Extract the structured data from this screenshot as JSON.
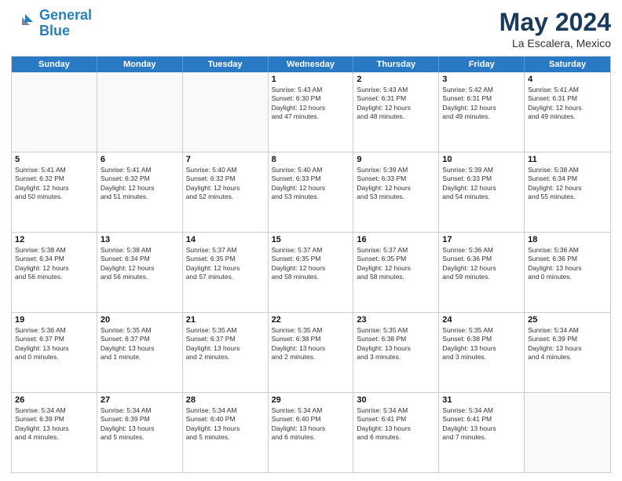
{
  "header": {
    "logo_line1": "General",
    "logo_line2": "Blue",
    "month": "May 2024",
    "location": "La Escalera, Mexico"
  },
  "weekdays": [
    "Sunday",
    "Monday",
    "Tuesday",
    "Wednesday",
    "Thursday",
    "Friday",
    "Saturday"
  ],
  "rows": [
    [
      {
        "day": "",
        "text": "",
        "empty": true
      },
      {
        "day": "",
        "text": "",
        "empty": true
      },
      {
        "day": "",
        "text": "",
        "empty": true
      },
      {
        "day": "1",
        "text": "Sunrise: 5:43 AM\nSunset: 6:30 PM\nDaylight: 12 hours\nand 47 minutes."
      },
      {
        "day": "2",
        "text": "Sunrise: 5:43 AM\nSunset: 6:31 PM\nDaylight: 12 hours\nand 48 minutes."
      },
      {
        "day": "3",
        "text": "Sunrise: 5:42 AM\nSunset: 6:31 PM\nDaylight: 12 hours\nand 49 minutes."
      },
      {
        "day": "4",
        "text": "Sunrise: 5:41 AM\nSunset: 6:31 PM\nDaylight: 12 hours\nand 49 minutes."
      }
    ],
    [
      {
        "day": "5",
        "text": "Sunrise: 5:41 AM\nSunset: 6:32 PM\nDaylight: 12 hours\nand 50 minutes."
      },
      {
        "day": "6",
        "text": "Sunrise: 5:41 AM\nSunset: 6:32 PM\nDaylight: 12 hours\nand 51 minutes."
      },
      {
        "day": "7",
        "text": "Sunrise: 5:40 AM\nSunset: 6:32 PM\nDaylight: 12 hours\nand 52 minutes."
      },
      {
        "day": "8",
        "text": "Sunrise: 5:40 AM\nSunset: 6:33 PM\nDaylight: 12 hours\nand 53 minutes."
      },
      {
        "day": "9",
        "text": "Sunrise: 5:39 AM\nSunset: 6:33 PM\nDaylight: 12 hours\nand 53 minutes."
      },
      {
        "day": "10",
        "text": "Sunrise: 5:39 AM\nSunset: 6:33 PM\nDaylight: 12 hours\nand 54 minutes."
      },
      {
        "day": "11",
        "text": "Sunrise: 5:38 AM\nSunset: 6:34 PM\nDaylight: 12 hours\nand 55 minutes."
      }
    ],
    [
      {
        "day": "12",
        "text": "Sunrise: 5:38 AM\nSunset: 6:34 PM\nDaylight: 12 hours\nand 56 minutes."
      },
      {
        "day": "13",
        "text": "Sunrise: 5:38 AM\nSunset: 6:34 PM\nDaylight: 12 hours\nand 56 minutes."
      },
      {
        "day": "14",
        "text": "Sunrise: 5:37 AM\nSunset: 6:35 PM\nDaylight: 12 hours\nand 57 minutes."
      },
      {
        "day": "15",
        "text": "Sunrise: 5:37 AM\nSunset: 6:35 PM\nDaylight: 12 hours\nand 58 minutes."
      },
      {
        "day": "16",
        "text": "Sunrise: 5:37 AM\nSunset: 6:35 PM\nDaylight: 12 hours\nand 58 minutes."
      },
      {
        "day": "17",
        "text": "Sunrise: 5:36 AM\nSunset: 6:36 PM\nDaylight: 12 hours\nand 59 minutes."
      },
      {
        "day": "18",
        "text": "Sunrise: 5:36 AM\nSunset: 6:36 PM\nDaylight: 13 hours\nand 0 minutes."
      }
    ],
    [
      {
        "day": "19",
        "text": "Sunrise: 5:36 AM\nSunset: 6:37 PM\nDaylight: 13 hours\nand 0 minutes."
      },
      {
        "day": "20",
        "text": "Sunrise: 5:35 AM\nSunset: 6:37 PM\nDaylight: 13 hours\nand 1 minute."
      },
      {
        "day": "21",
        "text": "Sunrise: 5:35 AM\nSunset: 6:37 PM\nDaylight: 13 hours\nand 2 minutes."
      },
      {
        "day": "22",
        "text": "Sunrise: 5:35 AM\nSunset: 6:38 PM\nDaylight: 13 hours\nand 2 minutes."
      },
      {
        "day": "23",
        "text": "Sunrise: 5:35 AM\nSunset: 6:38 PM\nDaylight: 13 hours\nand 3 minutes."
      },
      {
        "day": "24",
        "text": "Sunrise: 5:35 AM\nSunset: 6:38 PM\nDaylight: 13 hours\nand 3 minutes."
      },
      {
        "day": "25",
        "text": "Sunrise: 5:34 AM\nSunset: 6:39 PM\nDaylight: 13 hours\nand 4 minutes."
      }
    ],
    [
      {
        "day": "26",
        "text": "Sunrise: 5:34 AM\nSunset: 6:39 PM\nDaylight: 13 hours\nand 4 minutes."
      },
      {
        "day": "27",
        "text": "Sunrise: 5:34 AM\nSunset: 6:39 PM\nDaylight: 13 hours\nand 5 minutes."
      },
      {
        "day": "28",
        "text": "Sunrise: 5:34 AM\nSunset: 6:40 PM\nDaylight: 13 hours\nand 5 minutes."
      },
      {
        "day": "29",
        "text": "Sunrise: 5:34 AM\nSunset: 6:40 PM\nDaylight: 13 hours\nand 6 minutes."
      },
      {
        "day": "30",
        "text": "Sunrise: 5:34 AM\nSunset: 6:41 PM\nDaylight: 13 hours\nand 6 minutes."
      },
      {
        "day": "31",
        "text": "Sunrise: 5:34 AM\nSunset: 6:41 PM\nDaylight: 13 hours\nand 7 minutes."
      },
      {
        "day": "",
        "text": "",
        "empty": true
      }
    ]
  ]
}
